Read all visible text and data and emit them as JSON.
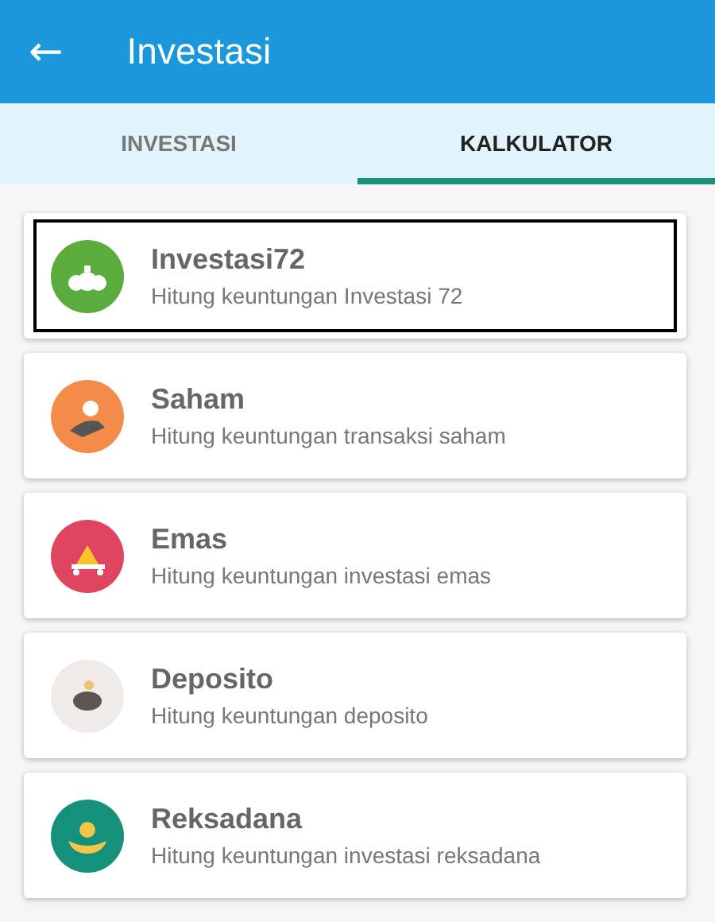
{
  "app_bar": {
    "back": "←",
    "title": "Investasi"
  },
  "tabs": [
    {
      "label": "INVESTASI",
      "selected": false
    },
    {
      "label": "KALKULATOR",
      "selected": true
    }
  ],
  "items": [
    {
      "title": "Investasi72",
      "subtitle": "Hitung keuntungan Investasi 72",
      "color": "#5aad3c",
      "focused": true
    },
    {
      "title": "Saham",
      "subtitle": "Hitung keuntungan transaksi saham",
      "color": "#f38b4a",
      "focused": false
    },
    {
      "title": "Emas",
      "subtitle": "Hitung keuntungan investasi emas",
      "color": "#e04560",
      "focused": false
    },
    {
      "title": "Deposito",
      "subtitle": "Hitung keuntungan deposito",
      "color": "#efebe9",
      "focused": false
    },
    {
      "title": "Reksadana",
      "subtitle": "Hitung keuntungan investasi reksadana",
      "color": "#15907a",
      "focused": false
    }
  ]
}
